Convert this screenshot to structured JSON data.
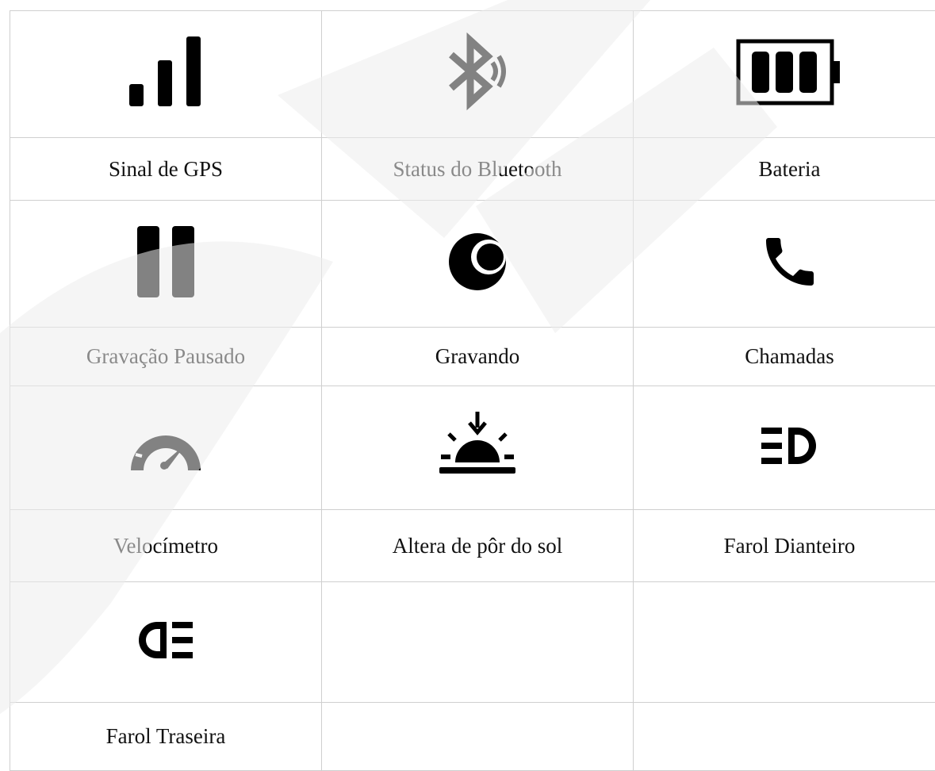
{
  "rows": [
    {
      "cells": [
        {
          "icon": "gps-signal-icon",
          "label": "Sinal de GPS"
        },
        {
          "icon": "bluetooth-icon",
          "label": "Status do Bluetooth"
        },
        {
          "icon": "battery-icon",
          "label": "Bateria"
        }
      ]
    },
    {
      "cells": [
        {
          "icon": "pause-icon",
          "label": "Gravação Pausado"
        },
        {
          "icon": "recording-icon",
          "label": "Gravando"
        },
        {
          "icon": "phone-icon",
          "label": "Chamadas"
        }
      ]
    },
    {
      "cells": [
        {
          "icon": "speedometer-icon",
          "label": "Velocímetro"
        },
        {
          "icon": "sunset-icon",
          "label": "Altera de pôr do sol"
        },
        {
          "icon": "headlight-icon",
          "label": "Farol Dianteiro"
        }
      ]
    },
    {
      "cells": [
        {
          "icon": "taillight-icon",
          "label": "Farol Traseira"
        },
        {
          "icon": "",
          "label": ""
        },
        {
          "icon": "",
          "label": ""
        }
      ]
    }
  ],
  "colors": {
    "icon": "#000000",
    "grid": "#cfcfcf",
    "text": "#111111",
    "watermark": "#efefef"
  }
}
